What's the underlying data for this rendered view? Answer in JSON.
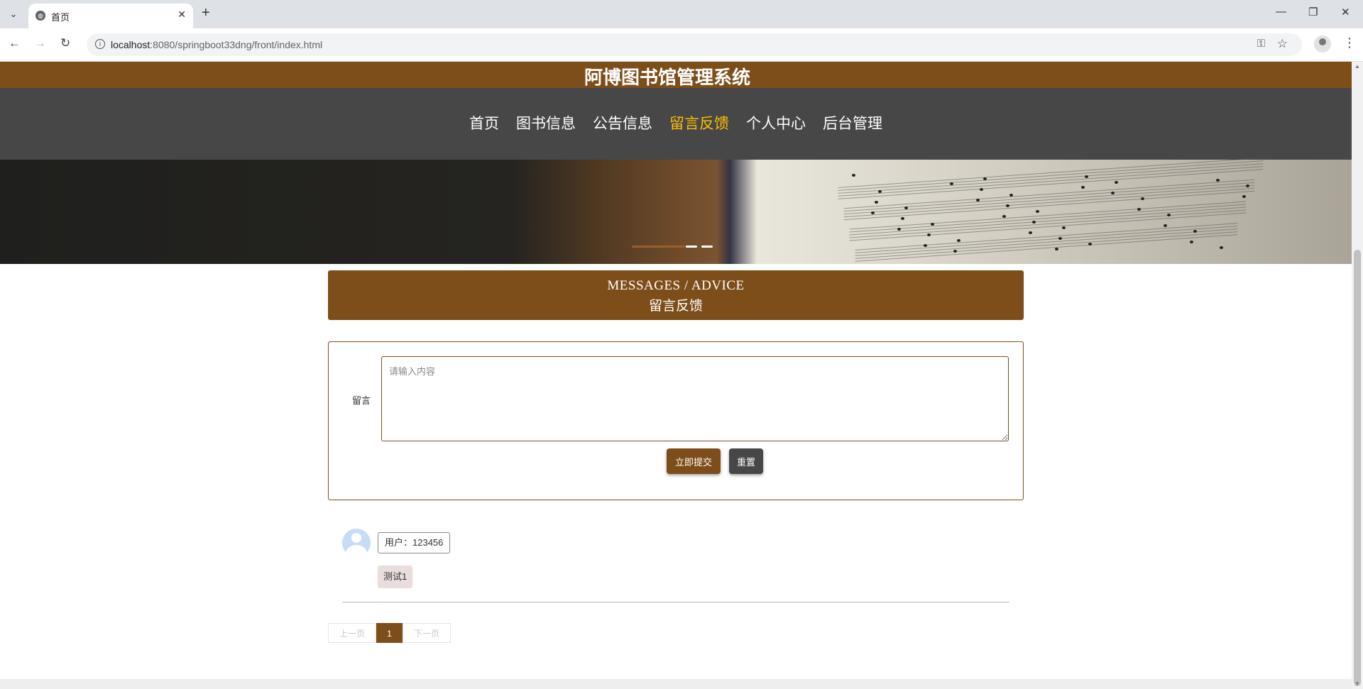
{
  "browser": {
    "tab_title": "首页",
    "url_host": "localhost",
    "url_rest": ":8080/springboot33dng/front/index.html"
  },
  "site": {
    "title": "阿博图书馆管理系统",
    "nav": [
      {
        "label": "首页",
        "active": false
      },
      {
        "label": "图书信息",
        "active": false
      },
      {
        "label": "公告信息",
        "active": false
      },
      {
        "label": "留言反馈",
        "active": true
      },
      {
        "label": "个人中心",
        "active": false
      },
      {
        "label": "后台管理",
        "active": false
      }
    ]
  },
  "section": {
    "title_en": "MESSAGES / ADVICE",
    "title_cn": "留言反馈"
  },
  "form": {
    "label": "留言",
    "placeholder": "请输入内容",
    "value": "",
    "submit_label": "立即提交",
    "reset_label": "重置"
  },
  "comments": [
    {
      "user": "用户：123456",
      "content": "测试1"
    }
  ],
  "pagination": {
    "prev_label": "上一页",
    "current_page": "1",
    "next_label": "下一页"
  },
  "colors": {
    "brand": "#7d4e19",
    "nav_bg": "#474747",
    "nav_active": "#ffbe00"
  }
}
